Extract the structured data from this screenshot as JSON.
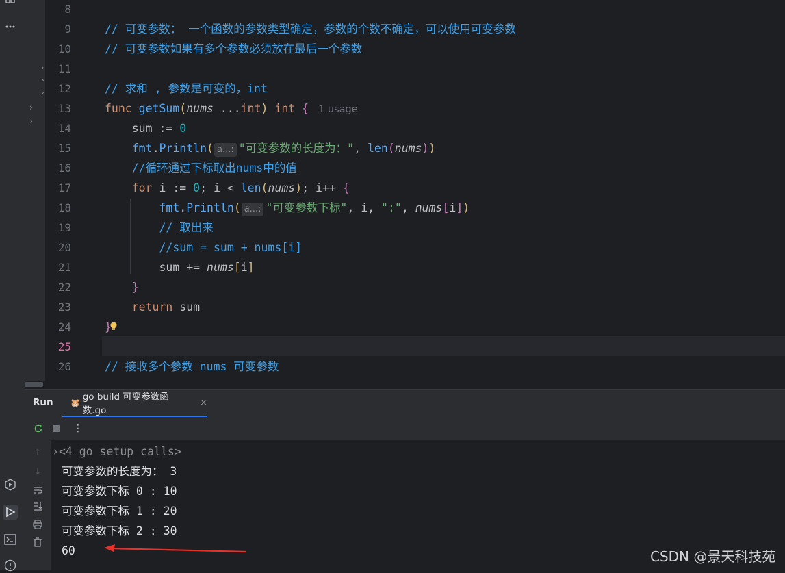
{
  "editor": {
    "lines": [
      {
        "no": "8",
        "tokens": []
      },
      {
        "no": "9",
        "tokens": [
          [
            "cmt",
            "// 可变参数： 一个函数的参数类型确定，参数的个数不确定，可以使用可变参数"
          ]
        ]
      },
      {
        "no": "10",
        "tokens": [
          [
            "cmt",
            "// 可变参数如果有多个参数必须放在最后一个参数"
          ]
        ]
      },
      {
        "no": "11",
        "tokens": []
      },
      {
        "no": "12",
        "tokens": [
          [
            "cmt",
            "// 求和 , 参数是可变的，int"
          ]
        ]
      },
      {
        "no": "13",
        "tokens": [
          [
            "kw",
            "func "
          ],
          [
            "fn",
            "getSum"
          ],
          [
            "br1",
            "("
          ],
          [
            "par",
            "nums"
          ],
          [
            "pkg",
            " ..."
          ],
          [
            "kw",
            "int"
          ],
          [
            "br1",
            ")"
          ],
          [
            "pkg",
            " "
          ],
          [
            "kw",
            "int"
          ],
          [
            "pkg",
            " "
          ],
          [
            "br2",
            "{"
          ],
          [
            "usage",
            "1 usage"
          ]
        ]
      },
      {
        "no": "14",
        "tokens": [
          [
            "pkg",
            "    sum := "
          ],
          [
            "num",
            "0"
          ]
        ]
      },
      {
        "no": "15",
        "tokens": [
          [
            "pkg",
            "    "
          ],
          [
            "call",
            "fmt"
          ],
          [
            "pkg",
            "."
          ],
          [
            "call",
            "Println"
          ],
          [
            "br1",
            "("
          ],
          [
            "hint",
            "a...:"
          ],
          [
            "str",
            "\"可变参数的长度为：\""
          ],
          [
            "pkg",
            ", "
          ],
          [
            "builtin",
            "len"
          ],
          [
            "br2",
            "("
          ],
          [
            "par",
            "nums"
          ],
          [
            "br2",
            ")"
          ],
          [
            "br1",
            ")"
          ]
        ]
      },
      {
        "no": "16",
        "tokens": [
          [
            "pkg",
            "    "
          ],
          [
            "cmt",
            "//循环通过下标取出nums中的值"
          ]
        ]
      },
      {
        "no": "17",
        "tokens": [
          [
            "pkg",
            "    "
          ],
          [
            "kw",
            "for"
          ],
          [
            "pkg",
            " i := "
          ],
          [
            "num",
            "0"
          ],
          [
            "pkg",
            "; i < "
          ],
          [
            "builtin",
            "len"
          ],
          [
            "br1",
            "("
          ],
          [
            "par",
            "nums"
          ],
          [
            "br1",
            ")"
          ],
          [
            "pkg",
            "; i++ "
          ],
          [
            "br2",
            "{"
          ]
        ]
      },
      {
        "no": "18",
        "tokens": [
          [
            "pkg",
            "        "
          ],
          [
            "call",
            "fmt"
          ],
          [
            "pkg",
            "."
          ],
          [
            "call",
            "Println"
          ],
          [
            "br1",
            "("
          ],
          [
            "hint",
            "a...:"
          ],
          [
            "str",
            "\"可变参数下标\""
          ],
          [
            "pkg",
            ", i, "
          ],
          [
            "str",
            "\":\""
          ],
          [
            "pkg",
            ", "
          ],
          [
            "par",
            "nums"
          ],
          [
            "br2",
            "["
          ],
          [
            "pkg",
            "i"
          ],
          [
            "br2",
            "]"
          ],
          [
            "br1",
            ")"
          ]
        ]
      },
      {
        "no": "19",
        "tokens": [
          [
            "pkg",
            "        "
          ],
          [
            "cmt",
            "// 取出来"
          ]
        ]
      },
      {
        "no": "20",
        "tokens": [
          [
            "pkg",
            "        "
          ],
          [
            "cmt",
            "//sum = sum + nums[i]"
          ]
        ]
      },
      {
        "no": "21",
        "tokens": [
          [
            "pkg",
            "        sum += "
          ],
          [
            "par",
            "nums"
          ],
          [
            "br1",
            "["
          ],
          [
            "pkg",
            "i"
          ],
          [
            "br1",
            "]"
          ]
        ]
      },
      {
        "no": "22",
        "tokens": [
          [
            "pkg",
            "    "
          ],
          [
            "br2",
            "}"
          ]
        ]
      },
      {
        "no": "23",
        "tokens": [
          [
            "pkg",
            "    "
          ],
          [
            "kw",
            "return"
          ],
          [
            "pkg",
            " sum"
          ]
        ]
      },
      {
        "no": "24",
        "tokens": [
          [
            "br2",
            "}"
          ]
        ]
      },
      {
        "no": "25",
        "tokens": []
      },
      {
        "no": "26",
        "tokens": [
          [
            "cmt",
            "// 接收多个参数 nums 可变参数"
          ]
        ]
      }
    ]
  },
  "run_panel": {
    "title": "Run",
    "tab_label": "go build 可变参数函数.go",
    "close_glyph": "×",
    "more_glyph": "⋮"
  },
  "console": {
    "lines": [
      {
        "text": "<4 go setup calls>",
        "folded": true
      },
      {
        "text": "可变参数的长度为： 3",
        "folded": false
      },
      {
        "text": "可变参数下标 0 : 10",
        "folded": false
      },
      {
        "text": "可变参数下标 1 : 20",
        "folded": false
      },
      {
        "text": "可变参数下标 2 : 30",
        "folded": false
      },
      {
        "text": "60",
        "folded": false
      }
    ]
  },
  "watermark": "CSDN @景天科技苑",
  "colors": {
    "comment": "#3fa0e8",
    "keyword": "#cf8e6d",
    "function": "#56a8f5",
    "string": "#6aab73",
    "number": "#2aacb8",
    "annotation_arrow": "#e8312b"
  }
}
